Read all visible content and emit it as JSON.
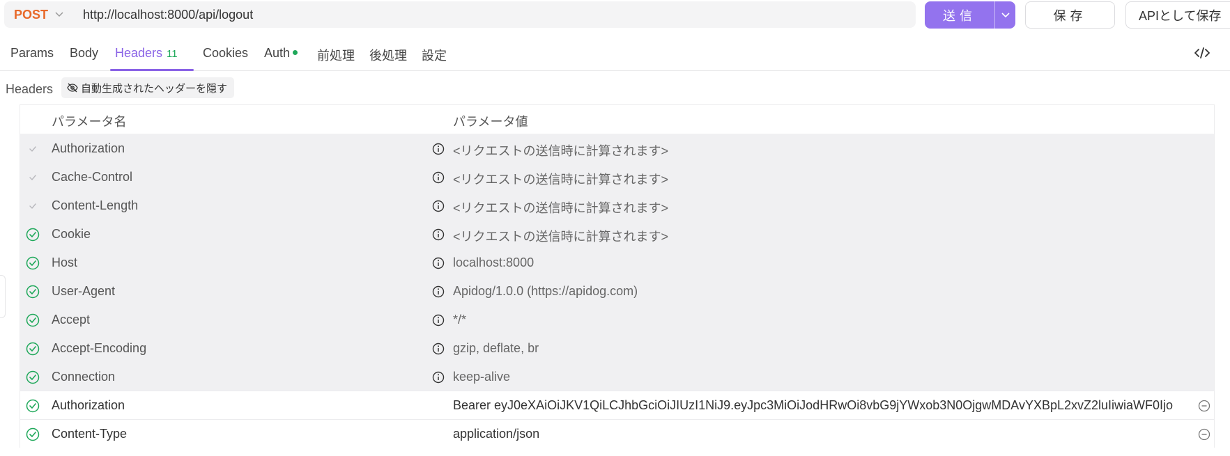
{
  "request": {
    "method": "POST",
    "url": "http://localhost:8000/api/logout",
    "send_label": "送信",
    "save_label": "保存",
    "save_api_label": "APIとして保存"
  },
  "tabs": [
    {
      "label": "Params"
    },
    {
      "label": "Body"
    },
    {
      "label": "Headers",
      "count": "11",
      "active": true
    },
    {
      "label": "Cookies"
    },
    {
      "label": "Auth",
      "status": "green-dot"
    },
    {
      "label": "前処理"
    },
    {
      "label": "後処理"
    },
    {
      "label": "設定"
    }
  ],
  "headers_section": {
    "label": "Headers",
    "hide_auto_label": "自動生成されたヘッダーを隠す",
    "columns": {
      "name": "パラメータ名",
      "value": "パラメータ値"
    }
  },
  "auto_rows": [
    {
      "name": "Authorization",
      "value": "<リクエストの送信時に計算されます>",
      "check": "checkmark-icon"
    },
    {
      "name": "Cache-Control",
      "value": "<リクエストの送信時に計算されます>",
      "check": "checkmark-icon"
    },
    {
      "name": "Content-Length",
      "value": "<リクエストの送信時に計算されます>",
      "check": "checkmark-icon"
    },
    {
      "name": "Cookie",
      "value": "<リクエストの送信時に計算されます>",
      "check": "check-circle-icon"
    },
    {
      "name": "Host",
      "value": "localhost:8000",
      "check": "check-circle-icon"
    },
    {
      "name": "User-Agent",
      "value": "Apidog/1.0.0 (https://apidog.com)",
      "check": "check-circle-icon"
    },
    {
      "name": "Accept",
      "value": "*/*",
      "check": "check-circle-icon"
    },
    {
      "name": "Accept-Encoding",
      "value": "gzip, deflate, br",
      "check": "check-circle-icon"
    },
    {
      "name": "Connection",
      "value": "keep-alive",
      "check": "check-circle-icon"
    }
  ],
  "custom_rows": [
    {
      "name": "Authorization",
      "value": "Bearer eyJ0eXAiOiJKV1QiLCJhbGciOiJIUzI1NiJ9.eyJpc3MiOiJodHRwOi8vbG9jYWxob3N0OjgwMDAvYXBpL2xvZ2luIiwiaWF0Ijo"
    },
    {
      "name": "Content-Type",
      "value": "application/json"
    }
  ],
  "colors": {
    "accent": "#9373ee",
    "tab_active": "#8a63e6",
    "method": "#e8692a",
    "enabled": "#1fa85a",
    "auto_row_bg": "#f0f0f2"
  }
}
